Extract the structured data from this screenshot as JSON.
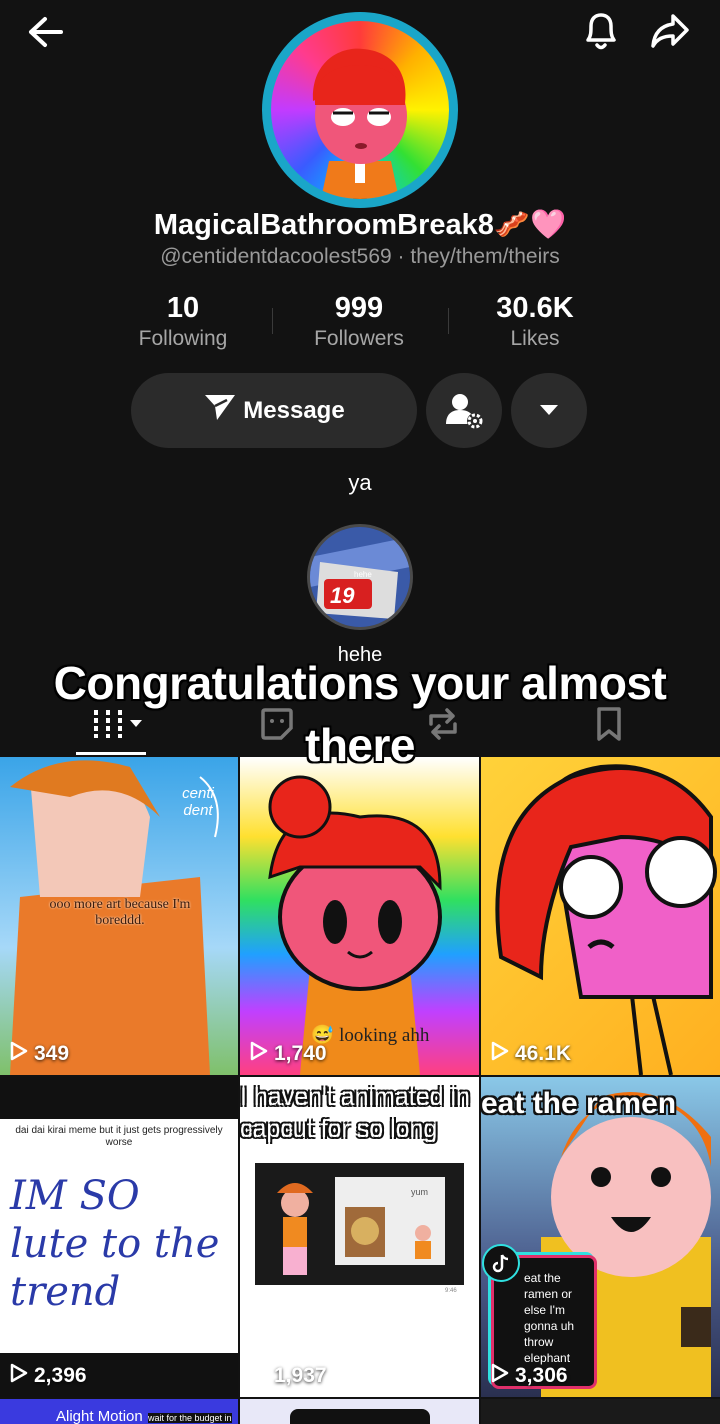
{
  "profile": {
    "display_name": "MagicalBathroomBreak8🥓🩷",
    "handle": "@centidentdacoolest569 · they/them/theirs",
    "bio": "ya"
  },
  "stats": [
    {
      "value": "10",
      "label": "Following"
    },
    {
      "value": "999",
      "label": "Followers"
    },
    {
      "value": "30.6K",
      "label": "Likes"
    }
  ],
  "actions": {
    "message_label": "Message"
  },
  "highlight": {
    "label": "hehe",
    "badge_text": "hehe",
    "badge_number": "19"
  },
  "overlay_caption": "Congratulations your almost there",
  "tabs": [
    "videos-tab",
    "reposts-tab",
    "reposts-tab",
    "saved-tab"
  ],
  "videos": [
    {
      "views": "349",
      "caption": "ooo more art because I'm boreddd.",
      "sign": "centi dent"
    },
    {
      "views": "1,740",
      "caption": "😅 looking ahh"
    },
    {
      "views": "46.1K",
      "caption": ""
    },
    {
      "views": "2,396",
      "caption": "dai dai kirai meme but it just gets progressively worse",
      "handwriting": "IM SO lute to the trend"
    },
    {
      "views": "1,937",
      "caption": "I haven't animated in capcut for so long",
      "inner": "yum",
      "time": "9:46"
    },
    {
      "views": "3,306",
      "caption": "eat the ramen",
      "sticker": "eat the ramen or else I'm gonna uh throw elephant"
    }
  ],
  "partial_row": {
    "left_caption": "Alight Motion",
    "left_sub": "wait for the budget in"
  },
  "colors": {
    "background": "#121212",
    "button": "#2b2b2b",
    "ring": "#1aa6c8"
  }
}
